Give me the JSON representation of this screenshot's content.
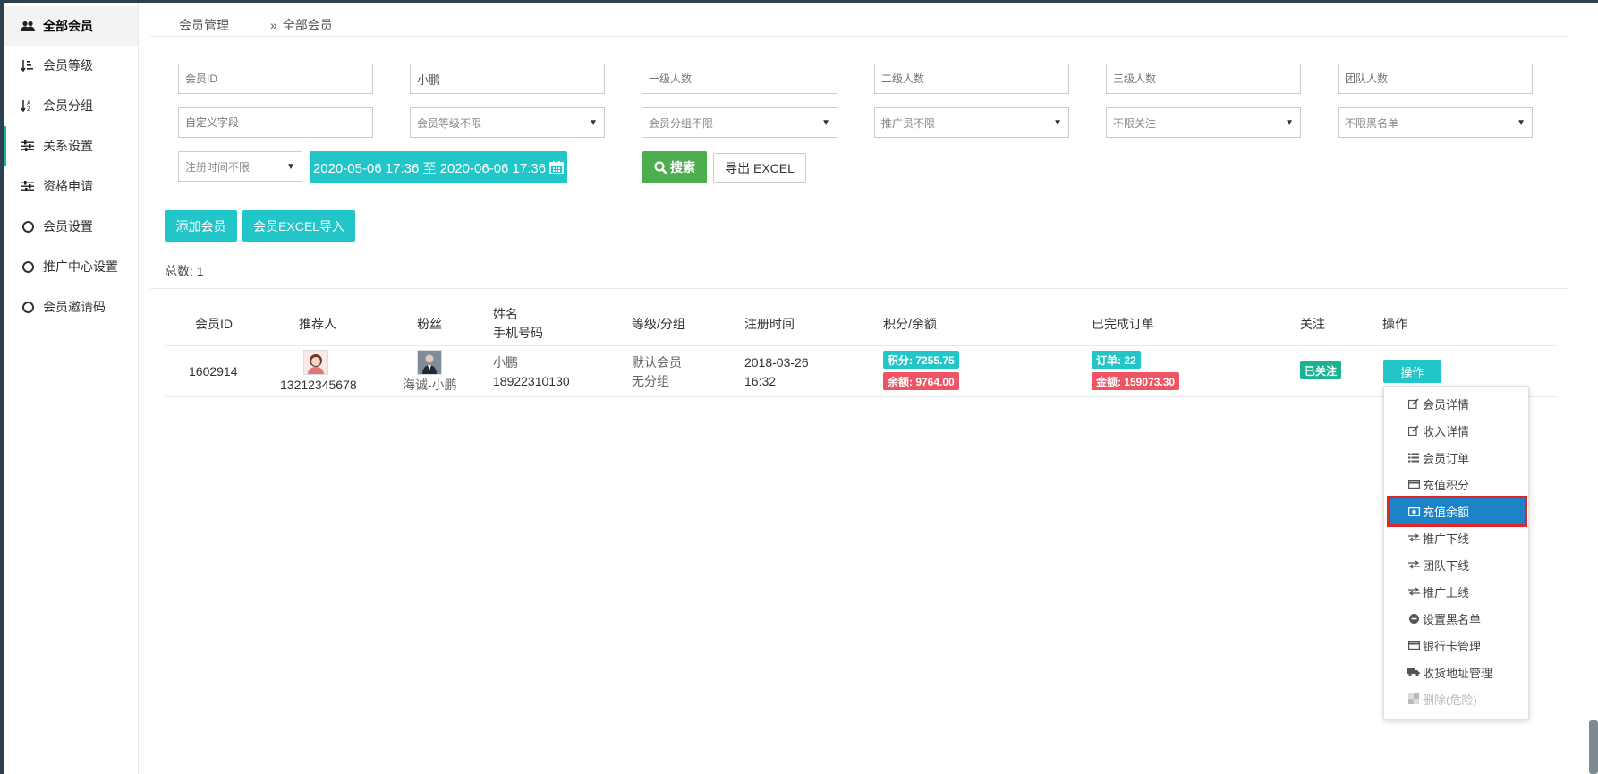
{
  "sidebar": {
    "items": [
      {
        "label": "全部会员",
        "icon": "users-icon"
      },
      {
        "label": "会员等级",
        "icon": "sort-amount-icon"
      },
      {
        "label": "会员分组",
        "icon": "sort-alpha-icon"
      },
      {
        "label": "关系设置",
        "icon": "sliders-icon"
      },
      {
        "label": "资格申请",
        "icon": "sliders-icon"
      },
      {
        "label": "会员设置",
        "icon": "circle-icon"
      },
      {
        "label": "推广中心设置",
        "icon": "circle-icon"
      },
      {
        "label": "会员邀请码",
        "icon": "circle-icon"
      }
    ]
  },
  "breadcrumb": {
    "parent": "会员管理",
    "separator": "»",
    "current": "全部会员"
  },
  "filters": {
    "member_id": {
      "placeholder": "会员ID",
      "value": ""
    },
    "name": {
      "placeholder": "",
      "value": "小鹏"
    },
    "level1": {
      "placeholder": "一级人数",
      "value": ""
    },
    "level2": {
      "placeholder": "二级人数",
      "value": ""
    },
    "level3": {
      "placeholder": "三级人数",
      "value": ""
    },
    "team": {
      "placeholder": "团队人数",
      "value": ""
    },
    "custom_field": {
      "placeholder": "自定义字段",
      "value": ""
    },
    "member_level": "会员等级不限",
    "member_group": "会员分组不限",
    "promoter": "推广员不限",
    "follow": "不限关注",
    "blacklist": "不限黑名单",
    "reg_time": "注册时间不限",
    "date_range": "2020-05-06 17:36 至 2020-06-06 17:36",
    "search_label": "搜索",
    "export_label": "导出 EXCEL"
  },
  "actions": {
    "add_member": "添加会员",
    "import_excel": "会员EXCEL导入"
  },
  "total": {
    "label": "总数:",
    "value": "1"
  },
  "table": {
    "headers": {
      "member_id": "会员ID",
      "referrer": "推荐人",
      "fans": "粉丝",
      "name_line1": "姓名",
      "name_line2": "手机号码",
      "level_group": "等级/分组",
      "reg_time": "注册时间",
      "points_balance": "积分/余额",
      "orders": "已完成订单",
      "follow": "关注",
      "ops": "操作"
    },
    "rows": [
      {
        "member_id": "1602914",
        "referrer": "13212345678",
        "fans": "海诚-小鹏",
        "name": "小鹏",
        "phone": "18922310130",
        "level": "默认会员",
        "group": "无分组",
        "reg_date": "2018-03-26",
        "reg_clock": "16:32",
        "points": "积分: 7255.75",
        "balance": "余额: 9764.00",
        "orders": "订单: 22",
        "amount": "金额: 159073.30",
        "follow": "已关注",
        "ops_label": "操作"
      }
    ]
  },
  "menu": {
    "items": [
      {
        "label": "会员详情",
        "icon": "edit-icon"
      },
      {
        "label": "收入详情",
        "icon": "edit-icon"
      },
      {
        "label": "会员订单",
        "icon": "list-icon"
      },
      {
        "label": "充值积分",
        "icon": "credit-card-icon"
      },
      {
        "label": "充值余额",
        "icon": "money-icon"
      },
      {
        "label": "推广下线",
        "icon": "exchange-icon"
      },
      {
        "label": "团队下线",
        "icon": "exchange-icon"
      },
      {
        "label": "推广上线",
        "icon": "exchange-icon"
      },
      {
        "label": "设置黑名单",
        "icon": "minus-circle-icon"
      },
      {
        "label": "银行卡管理",
        "icon": "credit-card-icon"
      },
      {
        "label": "收货地址管理",
        "icon": "truck-icon"
      },
      {
        "label": "删除(危险)",
        "icon": "trash-icon"
      }
    ]
  },
  "colors": {
    "info": "#23c6c8",
    "danger": "#ed5565",
    "success": "#1ab394",
    "search": "#4cae4c",
    "highlight": "#1c84c6",
    "highlight_border": "#e0242a"
  }
}
